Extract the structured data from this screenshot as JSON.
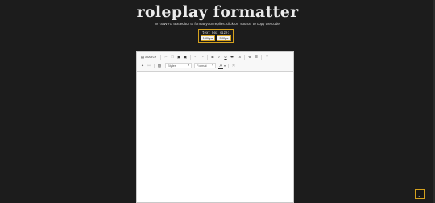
{
  "header": {
    "title": "roleplay formatter",
    "subtitle": "WYSIWYG text editor to format your replies. click on 'source' to copy the code!"
  },
  "size_box": {
    "label": "text box size:",
    "options": [
      "1000px",
      "540px"
    ]
  },
  "toolbar": {
    "source_label": "Source",
    "bold": "B",
    "italic": "I",
    "underline": "U",
    "strike": "S",
    "remove_format": "Tx",
    "quote": "❝",
    "styles_label": "Styles",
    "format_label": "Format",
    "text_color": "A"
  },
  "colors": {
    "accent": "#d4a11e",
    "background": "#1c1c1c"
  },
  "scroll_top_icon": "arrow-up-icon"
}
